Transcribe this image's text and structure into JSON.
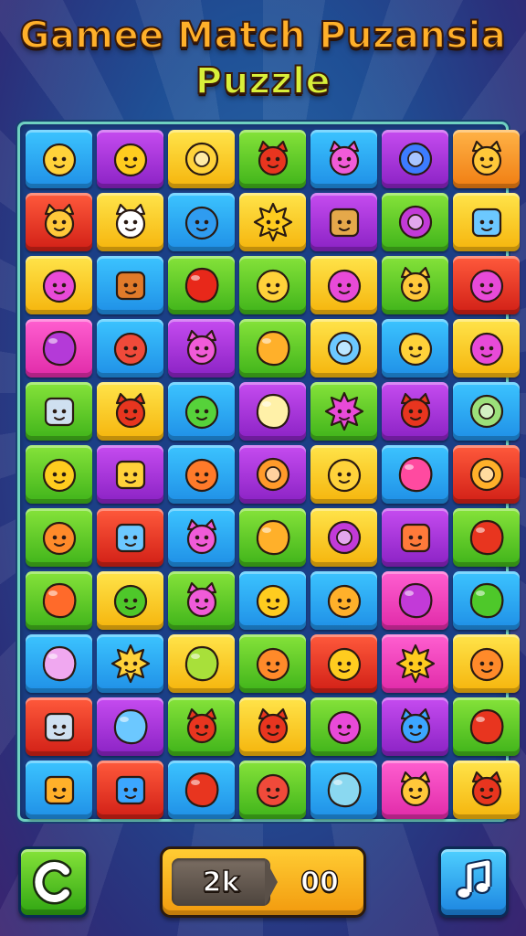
{
  "title": {
    "line1": "Gamee Match Puzansia",
    "line2": "Puzzle"
  },
  "board": {
    "rows": [
      [
        {
          "c": "blue",
          "i": "hero"
        },
        {
          "c": "purple",
          "i": "chick"
        },
        {
          "c": "yellow",
          "i": "donut"
        },
        {
          "c": "green",
          "i": "cat-red"
        },
        {
          "c": "blue",
          "i": "cat-pink"
        },
        {
          "c": "purple",
          "i": "orb"
        },
        {
          "c": "orange",
          "i": "cat-yellow"
        }
      ],
      [
        {
          "c": "red",
          "i": "cat-yellow"
        },
        {
          "c": "yellow",
          "i": "cat-white"
        },
        {
          "c": "blue",
          "i": "fish"
        },
        {
          "c": "yellow",
          "i": "sun"
        },
        {
          "c": "purple",
          "i": "sign"
        },
        {
          "c": "green",
          "i": "lollipop"
        },
        {
          "c": "yellow",
          "i": "jar"
        }
      ],
      [
        {
          "c": "yellow",
          "i": "blob-pink"
        },
        {
          "c": "blue",
          "i": "rock"
        },
        {
          "c": "green",
          "i": "apple"
        },
        {
          "c": "green",
          "i": "face-yellow"
        },
        {
          "c": "yellow",
          "i": "blob-pink"
        },
        {
          "c": "green",
          "i": "cat-yellow"
        },
        {
          "c": "red",
          "i": "blob-pink"
        }
      ],
      [
        {
          "c": "pink",
          "i": "fig"
        },
        {
          "c": "blue",
          "i": "blob-red"
        },
        {
          "c": "purple",
          "i": "cat-pink"
        },
        {
          "c": "green",
          "i": "croissant"
        },
        {
          "c": "yellow",
          "i": "button"
        },
        {
          "c": "blue",
          "i": "face-yellow"
        },
        {
          "c": "yellow",
          "i": "blob-pink"
        }
      ],
      [
        {
          "c": "green",
          "i": "bag"
        },
        {
          "c": "yellow",
          "i": "cat-red"
        },
        {
          "c": "blue",
          "i": "fish-green"
        },
        {
          "c": "purple",
          "i": "umbrella"
        },
        {
          "c": "green",
          "i": "star-pink"
        },
        {
          "c": "purple",
          "i": "cat-red"
        },
        {
          "c": "blue",
          "i": "candy"
        }
      ],
      [
        {
          "c": "green",
          "i": "chick"
        },
        {
          "c": "purple",
          "i": "basket"
        },
        {
          "c": "blue",
          "i": "fish-orange"
        },
        {
          "c": "purple",
          "i": "ball"
        },
        {
          "c": "yellow",
          "i": "face-yellow"
        },
        {
          "c": "blue",
          "i": "leaf"
        },
        {
          "c": "red",
          "i": "planet"
        }
      ],
      [
        {
          "c": "green",
          "i": "face-orange"
        },
        {
          "c": "red",
          "i": "pot"
        },
        {
          "c": "blue",
          "i": "cat-pink"
        },
        {
          "c": "green",
          "i": "croissant"
        },
        {
          "c": "yellow",
          "i": "planet-purple"
        },
        {
          "c": "purple",
          "i": "cake"
        },
        {
          "c": "green",
          "i": "bowl"
        }
      ],
      [
        {
          "c": "green",
          "i": "carrot"
        },
        {
          "c": "yellow",
          "i": "face-green"
        },
        {
          "c": "green",
          "i": "cat-pink"
        },
        {
          "c": "blue",
          "i": "chick"
        },
        {
          "c": "blue",
          "i": "bear"
        },
        {
          "c": "pink",
          "i": "plum"
        },
        {
          "c": "blue",
          "i": "bubble"
        }
      ],
      [
        {
          "c": "blue",
          "i": "wand"
        },
        {
          "c": "blue",
          "i": "starfish"
        },
        {
          "c": "yellow",
          "i": "bottle"
        },
        {
          "c": "green",
          "i": "face-orange"
        },
        {
          "c": "red",
          "i": "chick"
        },
        {
          "c": "pink",
          "i": "sun"
        },
        {
          "c": "yellow",
          "i": "face-orange"
        }
      ],
      [
        {
          "c": "red",
          "i": "bag"
        },
        {
          "c": "purple",
          "i": "vase"
        },
        {
          "c": "green",
          "i": "cat-red"
        },
        {
          "c": "yellow",
          "i": "cat-red"
        },
        {
          "c": "green",
          "i": "blob-pink"
        },
        {
          "c": "purple",
          "i": "cat-blue"
        },
        {
          "c": "green",
          "i": "bowl"
        }
      ],
      [
        {
          "c": "blue",
          "i": "lantern"
        },
        {
          "c": "red",
          "i": "basket-blue"
        },
        {
          "c": "blue",
          "i": "leaf-red"
        },
        {
          "c": "green",
          "i": "blob-red"
        },
        {
          "c": "blue",
          "i": "lightbulb"
        },
        {
          "c": "pink",
          "i": "cat-yellow"
        },
        {
          "c": "yellow",
          "i": "cat-red"
        }
      ]
    ]
  },
  "controls": {
    "restart_icon": "restart-icon",
    "music_icon": "music-note-icon",
    "score_left": "2k",
    "score_right": "00"
  }
}
